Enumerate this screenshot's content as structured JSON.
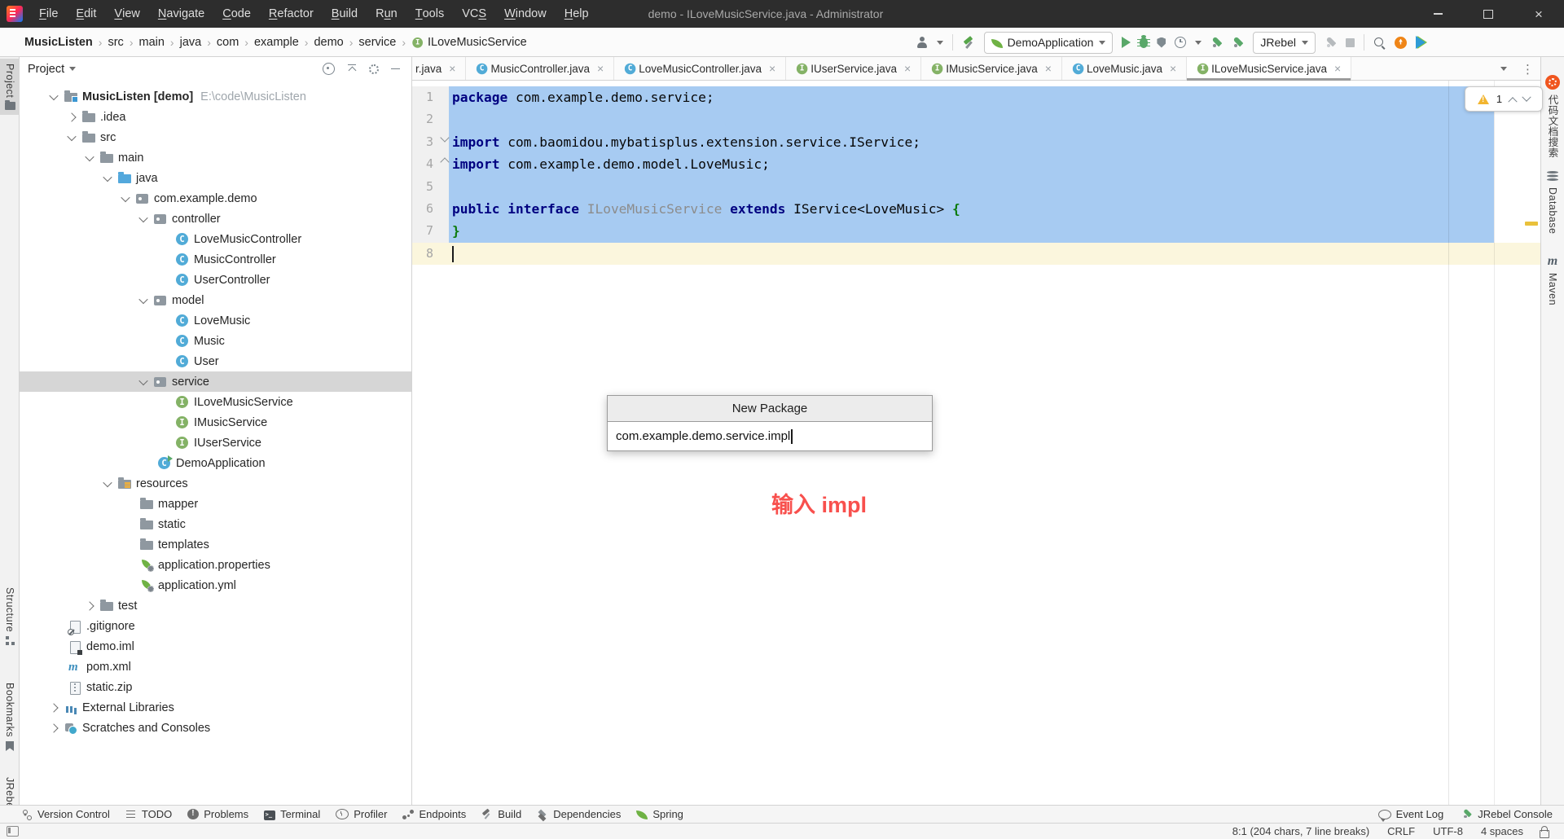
{
  "window": {
    "title": "demo - ILoveMusicService.java - Administrator",
    "menu": [
      {
        "label": "File",
        "mnemonic": 0
      },
      {
        "label": "Edit",
        "mnemonic": 0
      },
      {
        "label": "View",
        "mnemonic": 0
      },
      {
        "label": "Navigate",
        "mnemonic": 0
      },
      {
        "label": "Code",
        "mnemonic": 0
      },
      {
        "label": "Refactor",
        "mnemonic": 0
      },
      {
        "label": "Build",
        "mnemonic": 0
      },
      {
        "label": "Run",
        "mnemonic": 1
      },
      {
        "label": "Tools",
        "mnemonic": 0
      },
      {
        "label": "VCS",
        "mnemonic": 2
      },
      {
        "label": "Window",
        "mnemonic": 0
      },
      {
        "label": "Help",
        "mnemonic": 0
      }
    ]
  },
  "breadcrumbs": [
    {
      "label": "MusicListen",
      "bold": true
    },
    {
      "label": "src"
    },
    {
      "label": "main"
    },
    {
      "label": "java"
    },
    {
      "label": "com"
    },
    {
      "label": "example"
    },
    {
      "label": "demo"
    },
    {
      "label": "service"
    },
    {
      "label": "ILoveMusicService",
      "icon": "interface"
    }
  ],
  "toolbar": {
    "run_config": "DemoApplication",
    "jrebel_label": "JRebel"
  },
  "tabs": [
    {
      "label": "r.java",
      "icon": null,
      "active": false,
      "partial": true
    },
    {
      "label": "MusicController.java",
      "icon": "class",
      "active": false
    },
    {
      "label": "LoveMusicController.java",
      "icon": "class",
      "active": false
    },
    {
      "label": "IUserService.java",
      "icon": "interface",
      "active": false
    },
    {
      "label": "IMusicService.java",
      "icon": "interface",
      "active": false
    },
    {
      "label": "LoveMusic.java",
      "icon": "class",
      "active": false
    },
    {
      "label": "ILoveMusicService.java",
      "icon": "interface",
      "active": true
    }
  ],
  "project": {
    "header": "Project",
    "selected_item": "service",
    "tree": [
      {
        "label": "MusicListen [demo]",
        "path": "E:\\code\\MusicListen",
        "pad": 38,
        "chev": "open",
        "icon": "root",
        "bold": true
      },
      {
        "label": ".idea",
        "pad": 60,
        "chev": "closed",
        "icon": "folder"
      },
      {
        "label": "src",
        "pad": 60,
        "chev": "open",
        "icon": "folder"
      },
      {
        "label": "main",
        "pad": 82,
        "chev": "open",
        "icon": "folder"
      },
      {
        "label": "java",
        "pad": 104,
        "chev": "open",
        "icon": "folder-java"
      },
      {
        "label": "com.example.demo",
        "pad": 126,
        "chev": "open",
        "icon": "package"
      },
      {
        "label": "controller",
        "pad": 148,
        "chev": "open",
        "icon": "package"
      },
      {
        "label": "LoveMusicController",
        "pad": 192,
        "chev": "none",
        "icon": "class"
      },
      {
        "label": "MusicController",
        "pad": 192,
        "chev": "none",
        "icon": "class"
      },
      {
        "label": "UserController",
        "pad": 192,
        "chev": "none",
        "icon": "class"
      },
      {
        "label": "model",
        "pad": 148,
        "chev": "open",
        "icon": "package"
      },
      {
        "label": "LoveMusic",
        "pad": 192,
        "chev": "none",
        "icon": "class"
      },
      {
        "label": "Music",
        "pad": 192,
        "chev": "none",
        "icon": "class"
      },
      {
        "label": "User",
        "pad": 192,
        "chev": "none",
        "icon": "class"
      },
      {
        "label": "service",
        "pad": 148,
        "chev": "open",
        "icon": "package",
        "selected": true
      },
      {
        "label": "ILoveMusicService",
        "pad": 192,
        "chev": "none",
        "icon": "interface"
      },
      {
        "label": "IMusicService",
        "pad": 192,
        "chev": "none",
        "icon": "interface"
      },
      {
        "label": "IUserService",
        "pad": 192,
        "chev": "none",
        "icon": "interface"
      },
      {
        "label": "DemoApplication",
        "pad": 170,
        "chev": "none",
        "icon": "app"
      },
      {
        "label": "resources",
        "pad": 104,
        "chev": "open",
        "icon": "folder-res"
      },
      {
        "label": "mapper",
        "pad": 148,
        "chev": "none",
        "icon": "folder"
      },
      {
        "label": "static",
        "pad": 148,
        "chev": "none",
        "icon": "folder"
      },
      {
        "label": "templates",
        "pad": 148,
        "chev": "none",
        "icon": "folder"
      },
      {
        "label": "application.properties",
        "pad": 148,
        "chev": "none",
        "icon": "spring-config"
      },
      {
        "label": "application.yml",
        "pad": 148,
        "chev": "none",
        "icon": "spring-config"
      },
      {
        "label": "test",
        "pad": 82,
        "chev": "closed",
        "icon": "folder"
      },
      {
        "label": ".gitignore",
        "pad": 60,
        "chev": "none",
        "icon": "file-ignore"
      },
      {
        "label": "demo.iml",
        "pad": 60,
        "chev": "none",
        "icon": "file-iml"
      },
      {
        "label": "pom.xml",
        "pad": 60,
        "chev": "none",
        "icon": "maven"
      },
      {
        "label": "static.zip",
        "pad": 60,
        "chev": "none",
        "icon": "file-zip"
      },
      {
        "label": "External Libraries",
        "pad": 38,
        "chev": "closed",
        "icon": "libraries"
      },
      {
        "label": "Scratches and Consoles",
        "pad": 38,
        "chev": "closed",
        "icon": "scratches"
      }
    ]
  },
  "editor": {
    "lines": [
      {
        "num": "1",
        "segments": [
          {
            "s": "sk",
            "t": "package"
          },
          {
            "s": "sp",
            "t": " com.example.demo.service;"
          }
        ]
      },
      {
        "num": "2",
        "segments": []
      },
      {
        "num": "3",
        "segments": [
          {
            "s": "sk",
            "t": "import"
          },
          {
            "s": "sp",
            "t": " com.baomidou.mybatisplus.extension.service.IService;"
          }
        ]
      },
      {
        "num": "4",
        "segments": [
          {
            "s": "sk",
            "t": "import"
          },
          {
            "s": "sp",
            "t": " com.example.demo.model.LoveMusic;"
          }
        ]
      },
      {
        "num": "5",
        "segments": []
      },
      {
        "num": "6",
        "segments": [
          {
            "s": "sk",
            "t": "public"
          },
          {
            "s": "sp",
            "t": " "
          },
          {
            "s": "sk",
            "t": "interface"
          },
          {
            "s": "sp",
            "t": " "
          },
          {
            "s": "sd",
            "t": "ILoveMusicService"
          },
          {
            "s": "sp",
            "t": " "
          },
          {
            "s": "sk",
            "t": "extends"
          },
          {
            "s": "sp",
            "t": " IService<LoveMusic> "
          },
          {
            "s": "sb",
            "t": "{"
          }
        ]
      },
      {
        "num": "7",
        "segments": [
          {
            "s": "sb",
            "t": "}"
          }
        ]
      },
      {
        "num": "8",
        "segments": []
      }
    ],
    "inspection_warning_count": "1"
  },
  "dialog": {
    "title": "New Package",
    "value": "com.example.demo.service.impl"
  },
  "annotation": "输入 impl",
  "bottom_tools": {
    "left": [
      {
        "label": "Version Control",
        "icon": "branch"
      },
      {
        "label": "TODO",
        "icon": "todo"
      },
      {
        "label": "Problems",
        "icon": "problems"
      },
      {
        "label": "Terminal",
        "icon": "terminal"
      },
      {
        "label": "Profiler",
        "icon": "profiler-clock"
      },
      {
        "label": "Endpoints",
        "icon": "endpoints"
      },
      {
        "label": "Build",
        "icon": "build-hammer"
      },
      {
        "label": "Dependencies",
        "icon": "layers"
      },
      {
        "label": "Spring",
        "icon": "spring-leaf"
      }
    ],
    "right": [
      {
        "label": "Event Log",
        "icon": "balloon"
      },
      {
        "label": "JRebel Console",
        "icon": "rocket"
      }
    ]
  },
  "status_bar": {
    "segments": [
      "8:1 (204 chars, 7 line breaks)",
      "CRLF",
      "UTF-8",
      "4 spaces"
    ]
  },
  "left_stripe": {
    "top": [
      "Project"
    ],
    "bottom": [
      "Structure",
      "Bookmarks",
      "JRebel"
    ]
  },
  "right_stripe": [
    "代码文档搜索",
    "Database",
    "Maven"
  ],
  "colors": {
    "selection": "#A7CBF2",
    "current_line": "#FBF6DD",
    "keyword": "#000080",
    "brace": "#0B7A0B",
    "unused_symbol": "#8C8C8C",
    "class_icon": "#51ABD7",
    "interface_icon": "#84B266",
    "warning_stripe": "#E9C13B",
    "annotation_red": "#F8504D",
    "titlebar": "#2D2D2D",
    "selected_row": "#D6D6D6"
  }
}
